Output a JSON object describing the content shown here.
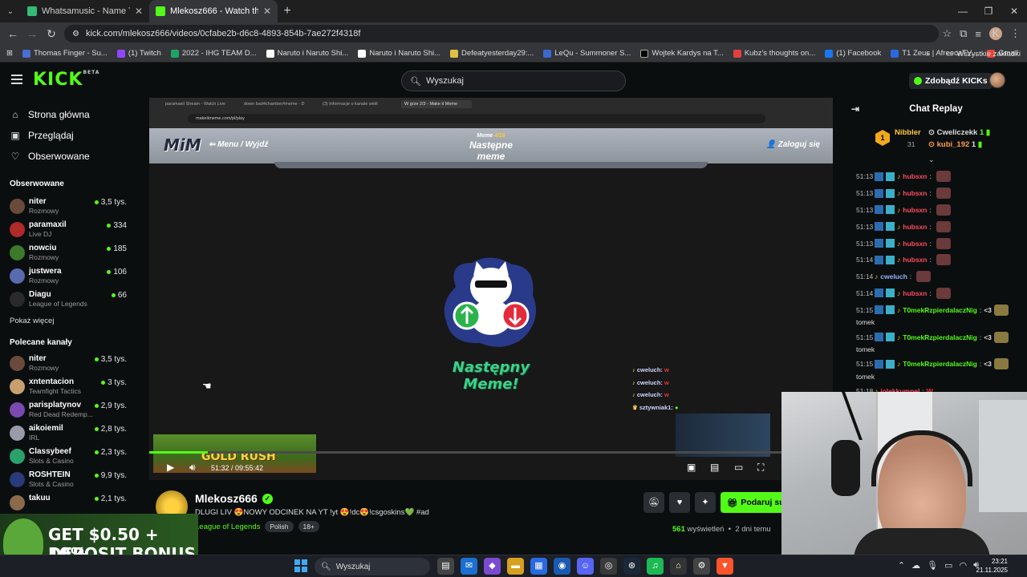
{
  "browser": {
    "tabs": [
      {
        "title": "Whatsamusic - Name That Tune",
        "active": false
      },
      {
        "title": "Mlekosz666 - Watch the VOD o",
        "active": true
      }
    ],
    "url": "kick.com/mlekosz666/videos/0cfabe2b-d6c8-4893-854b-7ae272f4318f",
    "bookmarks": [
      "Thomas Finger - Su...",
      "(1) Twitch",
      "2022 - IHG TEAM D...",
      "Naruto i Naruto Shi...",
      "Naruto i Naruto Shi...",
      "Defeatyesterday29:...",
      "LeQu - Summoner S...",
      "Wojtek Kardys na T...",
      "Kubz's thoughts on...",
      "(1) Facebook",
      "T1 Zeus | AfreecaTV...",
      "Gmail"
    ],
    "bookmarks_all": "Wszystkie zakładki",
    "profile_initial": "K"
  },
  "header": {
    "logo": "KICK",
    "logo_beta": "BETA",
    "search_placeholder": "Wyszukaj",
    "get_kicks": "Zdobądź KICKs"
  },
  "sidebar": {
    "nav": [
      {
        "label": "Strona główna",
        "icon": "home-icon"
      },
      {
        "label": "Przeglądaj",
        "icon": "browse-icon"
      },
      {
        "label": "Obserwowane",
        "icon": "heart-icon"
      }
    ],
    "followed_title": "Obserwowane",
    "followed": [
      {
        "name": "niter",
        "category": "Rozmowy",
        "viewers": "3,5 tys."
      },
      {
        "name": "paramaxil",
        "category": "Live DJ",
        "viewers": "334"
      },
      {
        "name": "nowciu",
        "category": "Rozmowy",
        "viewers": "185"
      },
      {
        "name": "justwera",
        "category": "Rozmowy",
        "viewers": "106"
      },
      {
        "name": "Diagu",
        "category": "League of Legends",
        "viewers": "66"
      }
    ],
    "show_more": "Pokaż więcej",
    "recommended_title": "Polecane kanały",
    "recommended": [
      {
        "name": "niter",
        "category": "Rozmowy",
        "viewers": "3,5 tys."
      },
      {
        "name": "xntentacion",
        "category": "Teamfight Tactics",
        "viewers": "3 tys."
      },
      {
        "name": "parisplatynov",
        "category": "Red Dead Redemp...",
        "viewers": "2,9 tys."
      },
      {
        "name": "aikoiemil",
        "category": "IRL",
        "viewers": "2,8 tys."
      },
      {
        "name": "Classybeef",
        "category": "Slots & Casino",
        "viewers": "2,3 tys."
      },
      {
        "name": "ROSHTEIN",
        "category": "Slots & Casino",
        "viewers": "9,9 tys."
      },
      {
        "name": "takuu",
        "category": "",
        "viewers": "2,1 tys."
      }
    ]
  },
  "video": {
    "inner_tabs": [
      "paramaxil Stream - Watch Live",
      "down bad4chamber#meme - D",
      "(3) Informacje o kanale wiolt",
      "W grze 2/3 - Make it Meme"
    ],
    "inner_url": "makeitmeme.com/pl/play",
    "mim_logo": "MiM",
    "mim_menu": "Menu / Wyjdź",
    "meme_counter_label": "Meme",
    "meme_counter": "4/16",
    "next_meme_top": "Następne meme",
    "login": "Zaloguj się",
    "next_meme": "Następny Meme!",
    "overlay_chat": [
      {
        "user": "cweluch:",
        "text": "w"
      },
      {
        "user": "cweluch:",
        "text": "w"
      },
      {
        "user": "cweluch:",
        "text": "w"
      },
      {
        "user": "sztywniak1:",
        "text": ""
      }
    ],
    "banner": "GOLD RUSH",
    "time": "51:32 / 09:55:42",
    "progress": 0.086
  },
  "channel": {
    "name": "Mlekosz666",
    "title": "DLUGI LIV 😍NOWY ODCINEK NA YT !yt 😍!dc😍!csgoskins💚 #ad",
    "category": "League of Legends",
    "tags": [
      "Polish",
      "18+"
    ],
    "gift_button": "Podaruj su",
    "views_count": "561",
    "views_label": "wyświetleń",
    "ago": "2 dni temu"
  },
  "chat": {
    "title": "Chat Replay",
    "pinned": {
      "rank": "1",
      "top_user": "Nibbler",
      "top_sub": "31",
      "user2": "Cweliczekk",
      "count2": "1",
      "user3": "kubi_192",
      "count3": "1"
    },
    "messages": [
      {
        "time": "51:13",
        "user": "hubsxn",
        "color": "#ff4b5c",
        "text": "",
        "emote": true,
        "badges": true
      },
      {
        "time": "51:13",
        "user": "hubsxn",
        "color": "#ff4b5c",
        "text": "",
        "emote": true,
        "badges": true
      },
      {
        "time": "51:13",
        "user": "hubsxn",
        "color": "#ff4b5c",
        "text": "",
        "emote": true,
        "badges": true
      },
      {
        "time": "51:13",
        "user": "hubsxn",
        "color": "#ff4b5c",
        "text": "",
        "emote": true,
        "badges": true
      },
      {
        "time": "51:13",
        "user": "hubsxn",
        "color": "#ff4b5c",
        "text": "",
        "emote": true,
        "badges": true
      },
      {
        "time": "51:14",
        "user": "hubsxn",
        "color": "#ff4b5c",
        "text": "",
        "emote": true,
        "badges": true
      },
      {
        "time": "51:14",
        "user": "cweluch",
        "color": "#8fb4ff",
        "text": "",
        "emote": true,
        "badges": false
      },
      {
        "time": "51:14",
        "user": "hubsxn",
        "color": "#ff4b5c",
        "text": "",
        "emote": true,
        "badges": true
      },
      {
        "time": "51:15",
        "user": "T0mekRzpierdalaczNig",
        "color": "#53fc18",
        "text": "<3",
        "emote2": true,
        "cont": "tomek"
      },
      {
        "time": "51:15",
        "user": "T0mekRzpierdalaczNig",
        "color": "#53fc18",
        "text": "<3",
        "emote2": true,
        "cont": "tomek"
      },
      {
        "time": "51:15",
        "user": "T0mekRzpierdalaczNig",
        "color": "#53fc18",
        "text": "<3",
        "emote2": true,
        "cont": "tomek"
      },
      {
        "time": "51:18",
        "user": "jolekkumpel",
        "color": "#ff4b5c",
        "text": "W",
        "badges": false
      }
    ]
  },
  "ad": {
    "line1": "GET $0.50 + 10%",
    "line2": "DEPOSIT BONUS"
  },
  "taskbar": {
    "search": "Wyszukaj",
    "time": "23:21",
    "date": "21.11.2025"
  }
}
